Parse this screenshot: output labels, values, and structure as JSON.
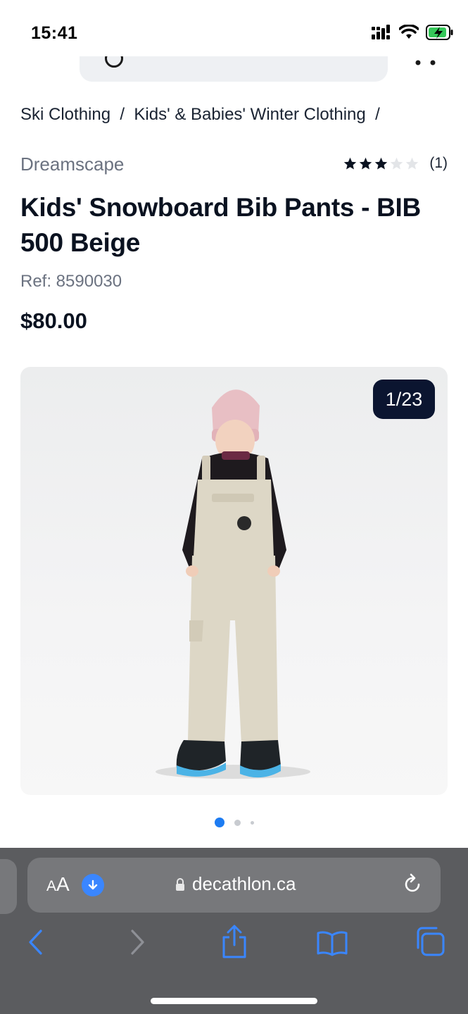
{
  "status_bar": {
    "time": "15:41"
  },
  "breadcrumb": {
    "items": [
      "Ski Clothing",
      "Kids' & Babies' Winter Clothing"
    ],
    "separator": "/"
  },
  "product": {
    "brand": "Dreamscape",
    "rating": {
      "value": 3,
      "max": 5,
      "count_text": "(1)"
    },
    "title": "Kids' Snowboard Bib Pants - BIB 500 Beige",
    "ref": "Ref: 8590030",
    "price": "$80.00",
    "image_counter": "1/23",
    "carousel": {
      "total_dots": 3,
      "active_index": 0
    }
  },
  "browser": {
    "aa_label_small": "A",
    "aa_label_large": "A",
    "url": "decathlon.ca"
  },
  "colors": {
    "accent_blue": "#3a86ff",
    "counter_bg": "#0b1530",
    "text_dark": "#0a1220",
    "text_muted": "#6b7280",
    "safari_bar": "#5b5c5f"
  },
  "icons": {
    "status": [
      "cellular-icon",
      "wifi-icon",
      "battery-charging-icon"
    ],
    "toolbar": [
      "back-icon",
      "forward-icon",
      "share-icon",
      "bookmarks-icon",
      "tabs-icon"
    ]
  }
}
